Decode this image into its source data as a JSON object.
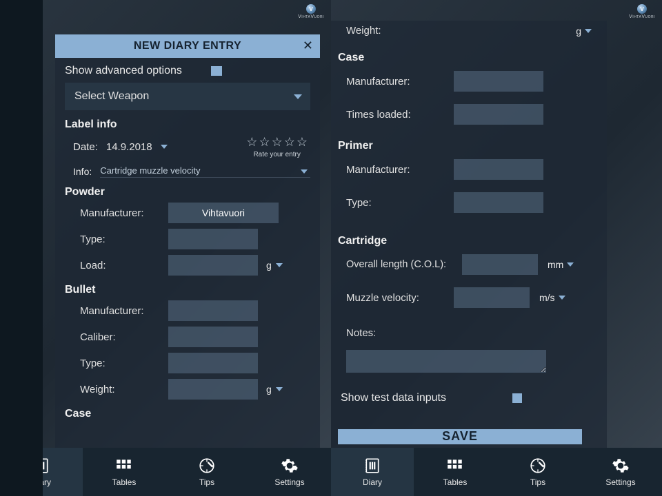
{
  "brand": "VihtaVuori",
  "modal": {
    "title": "NEW DIARY ENTRY",
    "show_advanced": "Show advanced options",
    "select_weapon": "Select Weapon",
    "label_info": "Label info",
    "date_label": "Date:",
    "date_value": "14.9.2018",
    "rate_text": "Rate your entry",
    "info_label": "Info:",
    "info_value": "Cartridge muzzle velocity",
    "powder_head": "Powder",
    "bullet_head": "Bullet",
    "case_head": "Case",
    "primer_head": "Primer",
    "cartridge_head": "Cartridge",
    "fields": {
      "manufacturer": "Manufacturer:",
      "type": "Type:",
      "load": "Load:",
      "caliber": "Caliber:",
      "weight": "Weight:",
      "times_loaded": "Times loaded:",
      "overall_length": "Overall length (C.O.L):",
      "muzzle_velocity": "Muzzle velocity:",
      "notes": "Notes:"
    },
    "values": {
      "powder_manufacturer": "Vihtavuori"
    },
    "units": {
      "g": "g",
      "mm": "mm",
      "ms": "m/s"
    },
    "show_test": "Show test data inputs",
    "save": "SAVE"
  },
  "nav": {
    "diary": "Diary",
    "tables": "Tables",
    "tips": "Tips",
    "settings": "Settings"
  }
}
